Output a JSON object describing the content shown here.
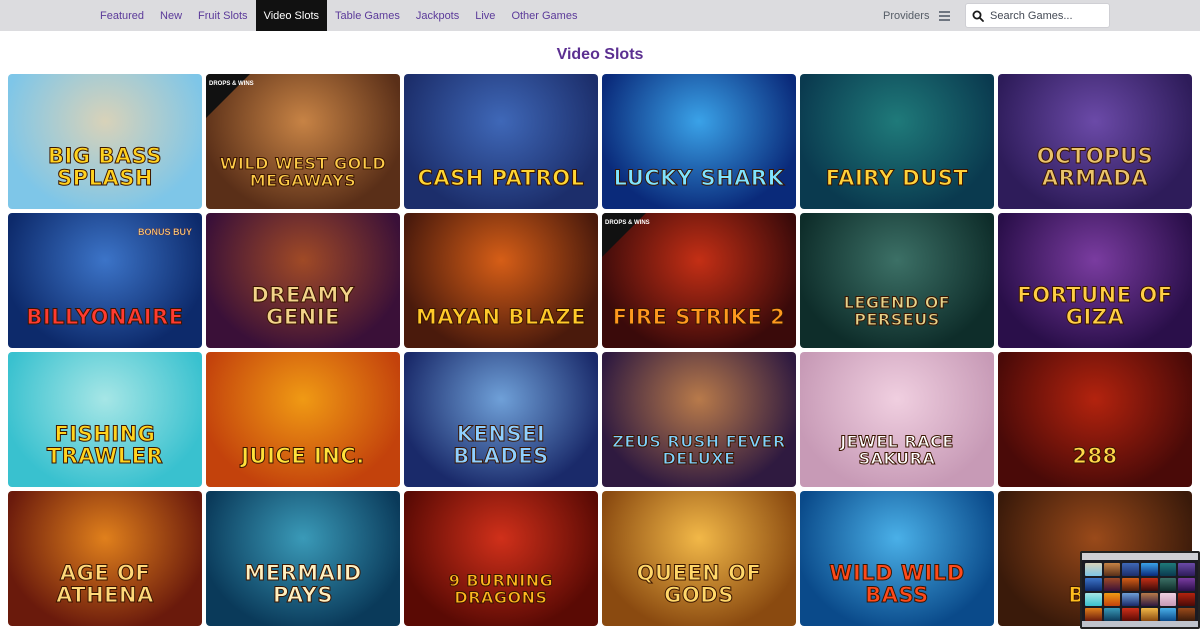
{
  "nav": {
    "items": [
      {
        "label": "Featured",
        "active": false
      },
      {
        "label": "New",
        "active": false
      },
      {
        "label": "Fruit Slots",
        "active": false
      },
      {
        "label": "Video Slots",
        "active": true
      },
      {
        "label": "Table Games",
        "active": false
      },
      {
        "label": "Jackpots",
        "active": false
      },
      {
        "label": "Live",
        "active": false
      },
      {
        "label": "Other Games",
        "active": false
      }
    ],
    "providers_label": "Providers",
    "menu_icon": "hamburger-icon",
    "search": {
      "placeholder": "Search Games...",
      "value": "",
      "icon": "search-icon"
    }
  },
  "page": {
    "title": "Video Slots"
  },
  "games": [
    {
      "title": "Big Bass Splash",
      "bg": [
        "#7ec6e8",
        "#d8d2b9"
      ],
      "text_color": "#ffd21f"
    },
    {
      "title": "Wild West Gold Megaways",
      "bg": [
        "#5a2f18",
        "#c78345"
      ],
      "text_color": "#ffce4a",
      "badge": "DROPS & WINS"
    },
    {
      "title": "Cash Patrol",
      "bg": [
        "#1c2e6b",
        "#3f68b8"
      ],
      "text_color": "#ffd633"
    },
    {
      "title": "Lucky Shark",
      "bg": [
        "#0a2a7a",
        "#3aa2e8"
      ],
      "text_color": "#7fe3ff"
    },
    {
      "title": "Fairy Dust",
      "bg": [
        "#0a3a4f",
        "#1f7a7a"
      ],
      "text_color": "#ffd23a"
    },
    {
      "title": "Octopus Armada",
      "bg": [
        "#2e1c5a",
        "#6b4aa8"
      ],
      "text_color": "#e9c36a"
    },
    {
      "title": "Billyonaire",
      "bg": [
        "#0d2a6b",
        "#3c74c8"
      ],
      "text_color": "#ff3b30",
      "corner": "BONUS BUY"
    },
    {
      "title": "Dreamy Genie",
      "bg": [
        "#3a1038",
        "#a04a26"
      ],
      "text_color": "#f2d48a"
    },
    {
      "title": "Mayan Blaze",
      "bg": [
        "#4a1a0c",
        "#d65e17"
      ],
      "text_color": "#ffca2a"
    },
    {
      "title": "Fire Strike 2",
      "bg": [
        "#3a0a0a",
        "#c42f15"
      ],
      "text_color": "#ff9a1f",
      "badge": "DROPS & WINS"
    },
    {
      "title": "Legend of Perseus",
      "bg": [
        "#0e2d2a",
        "#3c7066"
      ],
      "text_color": "#e6d48c"
    },
    {
      "title": "Fortune of Giza",
      "bg": [
        "#2a0f4a",
        "#7a3ca0"
      ],
      "text_color": "#ffcf45"
    },
    {
      "title": "Fishing Trawler",
      "bg": [
        "#39c1cf",
        "#a6e6e6"
      ],
      "text_color": "#ffd41f"
    },
    {
      "title": "Juice Inc.",
      "bg": [
        "#c3420c",
        "#f09a14"
      ],
      "text_color": "#ffe13a"
    },
    {
      "title": "Kensei Blades",
      "bg": [
        "#1a2a6a",
        "#6fa0d8"
      ],
      "text_color": "#8fd0ff"
    },
    {
      "title": "Zeus Rush Fever Deluxe",
      "bg": [
        "#2f1a40",
        "#b87a4a"
      ],
      "text_color": "#7fd3ff"
    },
    {
      "title": "Jewel Race Sakura",
      "bg": [
        "#c79ab6",
        "#f0cfe0"
      ],
      "text_color": "#ffffff"
    },
    {
      "title": "288",
      "bg": [
        "#4a0a08",
        "#b3230e"
      ],
      "text_color": "#ffd84a"
    },
    {
      "title": "Age of Athena",
      "bg": [
        "#6a1a0c",
        "#e0801c"
      ],
      "text_color": "#ffd97a"
    },
    {
      "title": "Mermaid Pays",
      "bg": [
        "#0a3a5a",
        "#3a9ab8"
      ],
      "text_color": "#fff0c0"
    },
    {
      "title": "9 Burning Dragons",
      "bg": [
        "#5a0a04",
        "#d0301a"
      ],
      "text_color": "#ffb81f"
    },
    {
      "title": "Queen of Gods",
      "bg": [
        "#8a4a10",
        "#f2b848"
      ],
      "text_color": "#ffd86a"
    },
    {
      "title": "Wild Wild Bass",
      "bg": [
        "#0a4a8a",
        "#4ab0e8"
      ],
      "text_color": "#ff4a1a"
    },
    {
      "title": "Boo",
      "bg": [
        "#3a1a0a",
        "#9a4a1a"
      ],
      "text_color": "#ffbf1f"
    }
  ]
}
